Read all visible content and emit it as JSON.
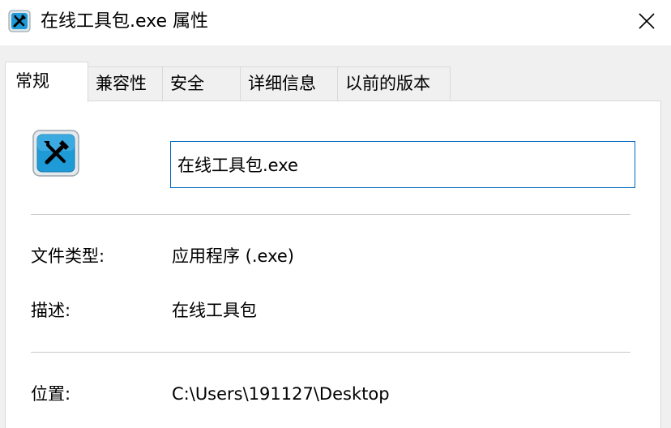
{
  "window": {
    "title": "在线工具包.exe 属性",
    "close_icon": "close-icon",
    "app_icon": "tools-icon"
  },
  "tabs": [
    {
      "label": "常规",
      "active": true
    },
    {
      "label": "兼容性",
      "active": false
    },
    {
      "label": "安全",
      "active": false
    },
    {
      "label": "详细信息",
      "active": false
    },
    {
      "label": "以前的版本",
      "active": false
    }
  ],
  "general": {
    "file_name": "在线工具包.exe",
    "file_type_label": "文件类型:",
    "file_type_value": "应用程序 (.exe)",
    "description_label": "描述:",
    "description_value": "在线工具包",
    "location_label": "位置:",
    "location_value": "C:\\Users\\191127\\Desktop"
  },
  "colors": {
    "focus_border": "#0067c0",
    "icon_blue": "#1e9ad6"
  }
}
